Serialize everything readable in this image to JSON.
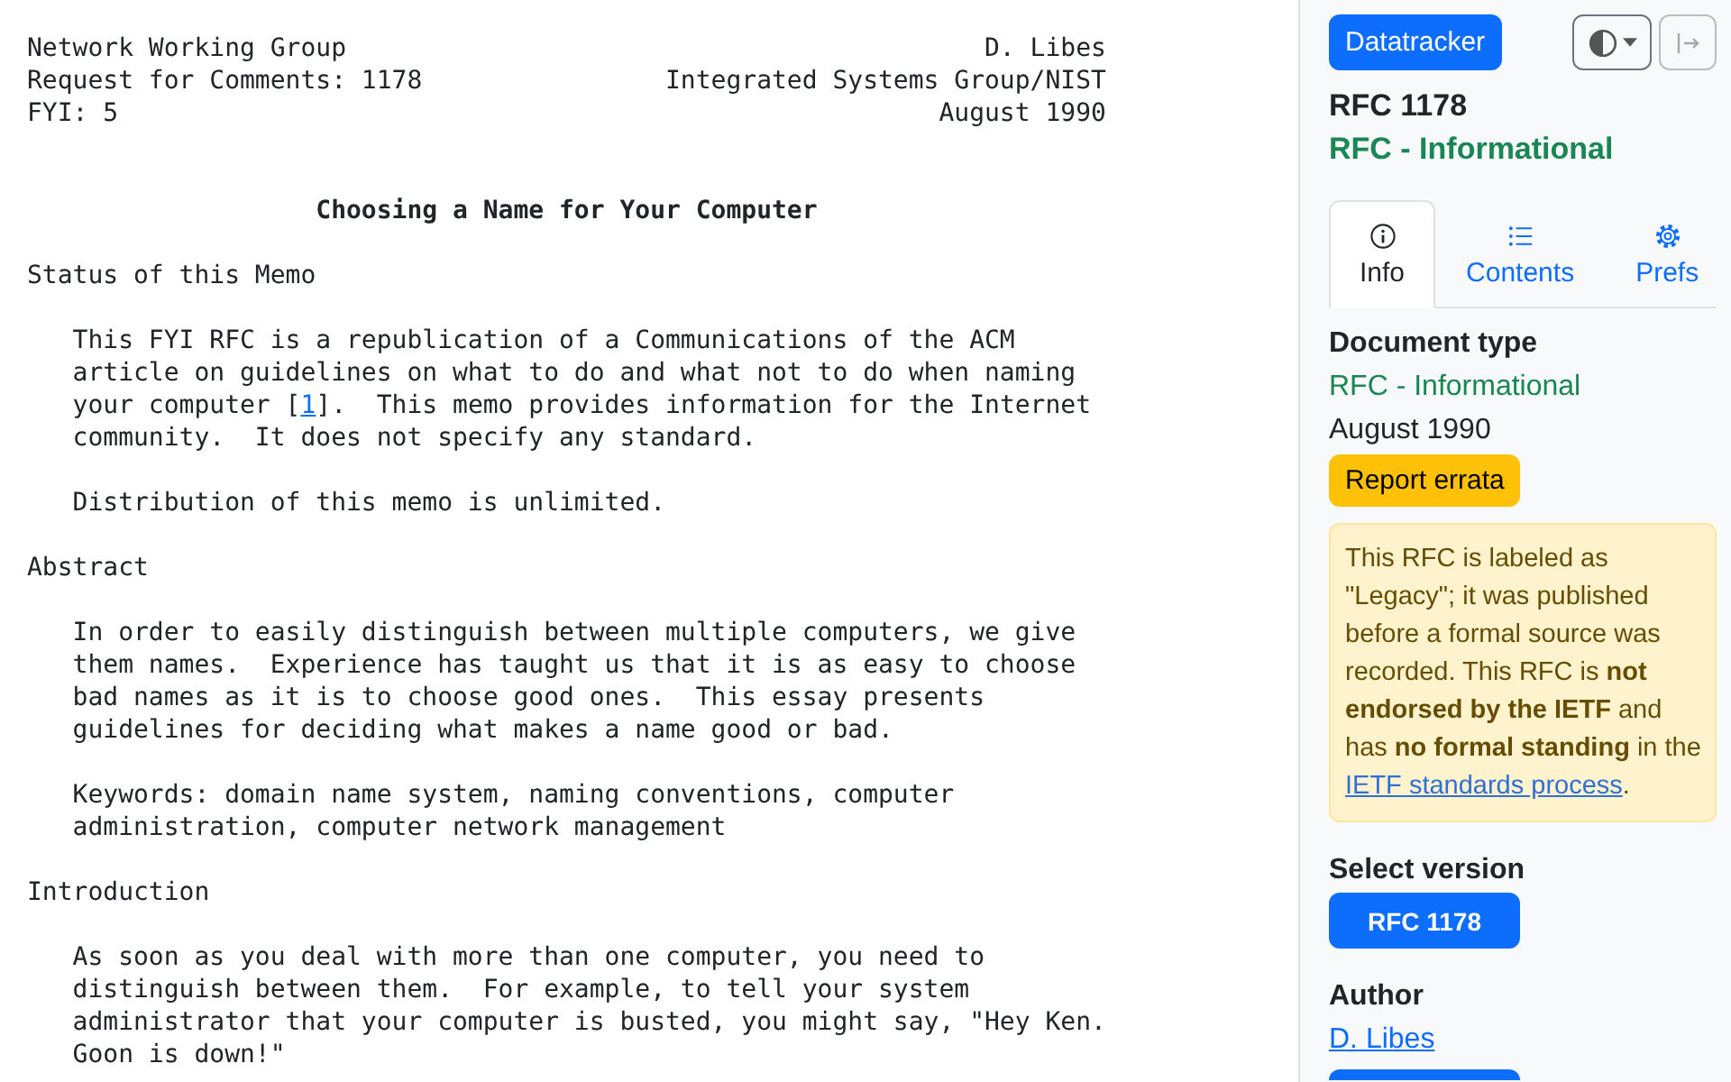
{
  "document": {
    "header": [
      {
        "left": "Network Working Group",
        "right": "D. Libes"
      },
      {
        "left": "Request for Comments: 1178",
        "right": "Integrated Systems Group/NIST"
      },
      {
        "left": "FYI: 5",
        "right": "August 1990"
      }
    ],
    "title": "Choosing a Name for Your Computer",
    "sections": [
      {
        "heading": "Status of this Memo",
        "paragraphs": [
          {
            "lines": [
              [
                {
                  "kind": "text",
                  "text": "This FYI RFC is a republication of a Communications of the ACM"
                }
              ],
              [
                {
                  "kind": "text",
                  "text": "article on guidelines on what to do and what not to do when naming"
                }
              ],
              [
                {
                  "kind": "text",
                  "text": "your computer ["
                },
                {
                  "kind": "link",
                  "text": "1"
                },
                {
                  "kind": "text",
                  "text": "].  This memo provides information for the Internet"
                }
              ],
              [
                {
                  "kind": "text",
                  "text": "community.  It does not specify any standard."
                }
              ]
            ]
          },
          {
            "lines": [
              [
                {
                  "kind": "text",
                  "text": "Distribution of this memo is unlimited."
                }
              ]
            ]
          }
        ]
      },
      {
        "heading": "Abstract",
        "paragraphs": [
          {
            "lines": [
              [
                {
                  "kind": "text",
                  "text": "In order to easily distinguish between multiple computers, we give"
                }
              ],
              [
                {
                  "kind": "text",
                  "text": "them names.  Experience has taught us that it is as easy to choose"
                }
              ],
              [
                {
                  "kind": "text",
                  "text": "bad names as it is to choose good ones.  This essay presents"
                }
              ],
              [
                {
                  "kind": "text",
                  "text": "guidelines for deciding what makes a name good or bad."
                }
              ]
            ]
          },
          {
            "lines": [
              [
                {
                  "kind": "text",
                  "text": "Keywords: domain name system, naming conventions, computer"
                }
              ],
              [
                {
                  "kind": "text",
                  "text": "administration, computer network management"
                }
              ]
            ]
          }
        ]
      },
      {
        "heading": "Introduction",
        "paragraphs": [
          {
            "lines": [
              [
                {
                  "kind": "text",
                  "text": "As soon as you deal with more than one computer, you need to"
                }
              ],
              [
                {
                  "kind": "text",
                  "text": "distinguish between them.  For example, to tell your system"
                }
              ],
              [
                {
                  "kind": "text",
                  "text": "administrator that your computer is busted, you might say, \"Hey Ken."
                }
              ],
              [
                {
                  "kind": "text",
                  "text": "Goon is down!\""
                }
              ]
            ]
          }
        ]
      }
    ]
  },
  "sidebar": {
    "home_button": "Datatracker",
    "collapse_button": {
      "disabled": true
    },
    "doc_name": "RFC 1178",
    "doc_status": "RFC - Informational",
    "tabs": [
      {
        "label": "Info",
        "selected": true
      },
      {
        "label": "Contents",
        "selected": false
      },
      {
        "label": "Prefs",
        "selected": false
      }
    ],
    "doc_type": {
      "heading": "Document type",
      "value": "RFC - Informational",
      "date": "August 1990"
    },
    "errata_button": "Report errata",
    "notice": {
      "text": "This RFC is labeled as \"Legacy\"; it was published before a formal source was recorded. This RFC is **not endorsed by the IETF** and has **no formal standing** in the",
      "link": "IETF standards process",
      "after": "."
    },
    "versions": {
      "heading": "Select version",
      "items": [
        {
          "label": "RFC 1178",
          "selected": true
        }
      ]
    },
    "author": {
      "heading": "Author",
      "names": [
        "D. Libes"
      ],
      "action_button": true
    }
  }
}
